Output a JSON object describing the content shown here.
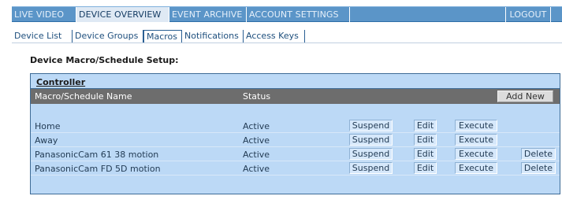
{
  "top_nav": {
    "tabs": [
      "LIVE VIDEO",
      "DEVICE OVERVIEW",
      "EVENT ARCHIVE",
      "ACCOUNT SETTINGS"
    ],
    "active_tab": "DEVICE OVERVIEW",
    "logout_label": "LOGOUT"
  },
  "sub_nav": {
    "tabs": [
      "Device List",
      "Device Groups",
      "Macros",
      "Notifications",
      "Access Keys"
    ],
    "active_tab": "Macros"
  },
  "page": {
    "heading": "Device Macro/Schedule Setup:",
    "controller_title": "Controller"
  },
  "table": {
    "col_name": "Macro/Schedule Name",
    "col_status": "Status",
    "add_new_label": "Add New",
    "rows": [
      {
        "name": "Home",
        "status": "Active",
        "suspend": "Suspend",
        "edit": "Edit",
        "execute": "Execute"
      },
      {
        "name": "Away",
        "status": "Active",
        "suspend": "Suspend",
        "edit": "Edit",
        "execute": "Execute"
      },
      {
        "name": "PanasonicCam 61 38 motion",
        "status": "Active",
        "suspend": "Suspend",
        "edit": "Edit",
        "execute": "Execute",
        "delete": "Delete"
      },
      {
        "name": "PanasonicCam FD 5D motion",
        "status": "Active",
        "suspend": "Suspend",
        "edit": "Edit",
        "execute": "Execute",
        "delete": "Delete"
      }
    ]
  },
  "colors": {
    "nav_blue": "#5b95c8",
    "panel_blue": "#bcd9f6",
    "header_gray": "#6d6d6d"
  }
}
